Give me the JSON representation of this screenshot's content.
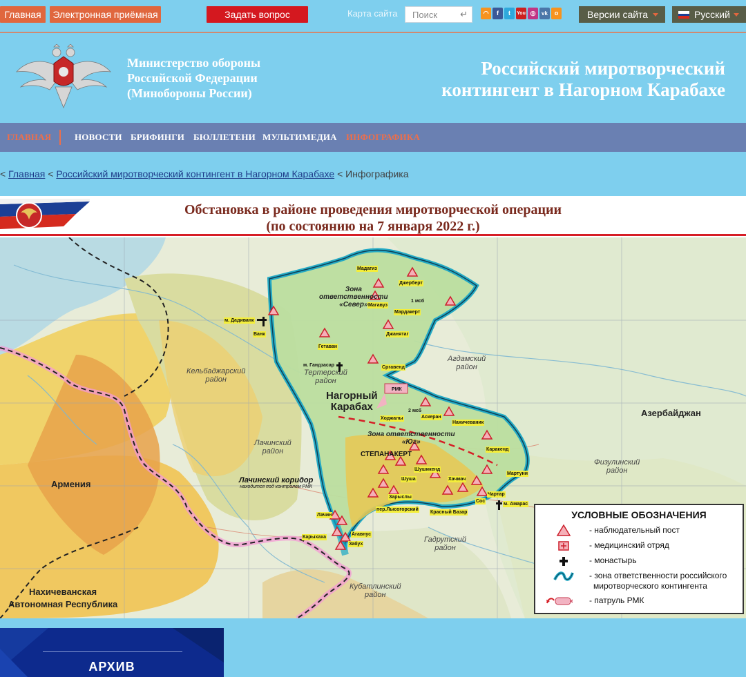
{
  "topbar": {
    "home": "Главная",
    "reception": "Электронная приёмная",
    "ask": "Задать вопрос",
    "sitemap": "Карта сайта",
    "search_placeholder": "Поиск",
    "versions": "Версии сайта",
    "language": "Русский",
    "socials": [
      {
        "icon": "rss-icon",
        "color": "#f7931e"
      },
      {
        "icon": "facebook-icon",
        "color": "#3b5998"
      },
      {
        "icon": "twitter-icon",
        "color": "#2fa8dc"
      },
      {
        "icon": "youtube-icon",
        "color": "#cd201f"
      },
      {
        "icon": "instagram-icon",
        "color": "#c13584"
      },
      {
        "icon": "vk-icon",
        "color": "#4a76a8"
      },
      {
        "icon": "odnoklassniki-icon",
        "color": "#f7931e"
      }
    ]
  },
  "header": {
    "ministry_line1": "Министерство обороны",
    "ministry_line2": "Российской Федерации",
    "ministry_line3": "(Минобороны России)",
    "contingent_line1": "Российский миротворческий",
    "contingent_line2": "контингент в Нагорном Карабахе"
  },
  "nav": {
    "items": [
      "ГЛАВНАЯ",
      "НОВОСТИ",
      "БРИФИНГИ",
      "БЮЛЛЕТЕНИ",
      "МУЛЬТИМЕДИА",
      "ИНФОГРАФИКА"
    ]
  },
  "breadcrumb": {
    "sep": "<",
    "home": "Главная",
    "section": "Российский миротворческий контингент в Нагорном Карабахе",
    "current": "Инфографика"
  },
  "infographic": {
    "title_line1": "Обстановка в районе проведения миротворческой операции",
    "title_line2": "(по состоянию на 7 января 2022 г.)",
    "labels": {
      "armenia": "Армения",
      "azerbaijan": "Азербайджан",
      "nakhichevan1": "Нахичеванская",
      "nakhichevan2": "Автономная Республика",
      "kelbajar1": "Кельбаджарский",
      "kelbajar2": "район",
      "lachin_r1": "Лачинский",
      "lachin_r2": "район",
      "terter1": "Тертерский",
      "terter2": "район",
      "agdam1": "Агдамский",
      "agdam2": "район",
      "fizuli1": "Физулинский",
      "fizuli2": "район",
      "gadrut1": "Гадрутский",
      "gadrut2": "район",
      "kubatli1": "Кубатлинский",
      "kubatli2": "район",
      "nk1": "Нагорный",
      "nk2": "Карабах",
      "zone_north1": "Зона",
      "zone_north2": "ответственности",
      "zone_north3": "«Север»",
      "zone_south1": "Зона ответственности",
      "zone_south2": "«Юг»",
      "corridor1": "Лачинский коридор",
      "corridor2": "находится под контролем РМК",
      "stepanakert": "СТЕПАНАКЕРТ"
    },
    "places": [
      "Мадагиз",
      "Джерберт",
      "Магавуз",
      "1 мсб",
      "Мардакерт",
      "м. Дадиванк",
      "Ванк",
      "Гетаван",
      "Джанятаг",
      "м. Гандзасар",
      "Сргавенд",
      "РМК",
      "2 мсб",
      "Ходжалы",
      "Аскеран",
      "Нахичеваник",
      "Каракенд",
      "Шушикенд",
      "Мартуни",
      "Шуша",
      "Хачмач",
      "Зарыслы",
      "Чартар",
      "пер.Лысогорский",
      "Красный Базар",
      "Сос",
      "м. Амарас",
      "Лачин",
      "Карыхаха",
      "Агавнус",
      "Забух"
    ],
    "legend": {
      "title": "УСЛОВНЫЕ ОБОЗНАЧЕНИЯ",
      "post": "- наблюдательный пост",
      "medical": "- медицинский отряд",
      "monastery": "- монастырь",
      "zone1": "- зона ответственности российского",
      "zone2": "миротворческого контингента",
      "patrol": "- патруль РМК"
    }
  },
  "archive": {
    "label": "АРХИВ"
  }
}
